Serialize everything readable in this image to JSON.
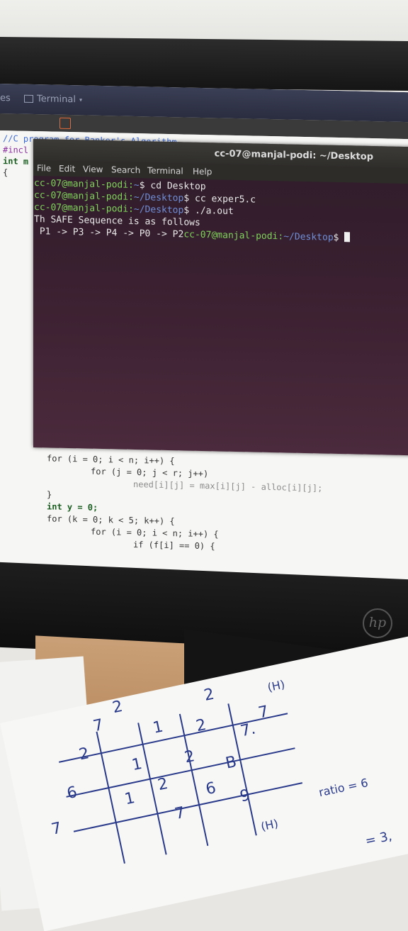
{
  "top_bar": {
    "activities_fragment": "es",
    "app_menu_label": "Terminal",
    "app_menu_arrow": "▾"
  },
  "editor": {
    "header_lines": [
      "//C program for Banker's Algorithm",
      "#incl",
      "int m",
      "{"
    ],
    "lines": [
      {
        "code": "for (i = 0; i < n; i++) {"
      },
      {
        "code": "for (j = 0; j < r; j++)"
      },
      {
        "code": "need[i][j] = max[i][j] - alloc[i][j];"
      },
      {
        "code": "}"
      },
      {
        "code": "int y = 0;"
      },
      {
        "code": "for (k = 0; k < 5; k++) {"
      },
      {
        "code": "for (i = 0; i < n; i++) {"
      },
      {
        "code": "if (f[i] == 0) {"
      }
    ]
  },
  "terminal": {
    "title": "cc-07@manjal-podi: ~/Desktop",
    "menu": [
      "File",
      "Edit",
      "View",
      "Search",
      "Terminal",
      "Help"
    ],
    "lines": [
      {
        "user": "cc-07@manjal-podi:",
        "path": "~",
        "cmd": "$ cd Desktop"
      },
      {
        "user": "cc-07@manjal-podi:",
        "path": "~/Desktop",
        "cmd": "$ cc exper5.c"
      },
      {
        "user": "cc-07@manjal-podi:",
        "path": "~/Desktop",
        "cmd": "$ ./a.out"
      }
    ],
    "output_line": "Th SAFE Sequence is as follows",
    "sequence_line": " P1 -> P3 -> P4 -> P0 -> P2",
    "final_prompt_user": "cc-07@manjal-podi:",
    "final_prompt_path": "~/Desktop",
    "final_prompt_symbol": "$ "
  },
  "monitor": {
    "brand": "hp"
  },
  "notebook": {
    "marks": [
      "7",
      "6",
      "2",
      "7",
      "2",
      "1",
      "1",
      "1",
      "2",
      "2",
      "2",
      "6",
      "7",
      "2",
      "B",
      "9",
      "7.",
      "7"
    ],
    "notes": [
      "ratio = 6",
      "= 3,",
      "(H)",
      "(H)"
    ]
  },
  "colors": {
    "terminal_bg": "#3a2030",
    "prompt_user": "#7fd45a",
    "prompt_path": "#6f8ed8",
    "ink": "#2a3a8a"
  }
}
